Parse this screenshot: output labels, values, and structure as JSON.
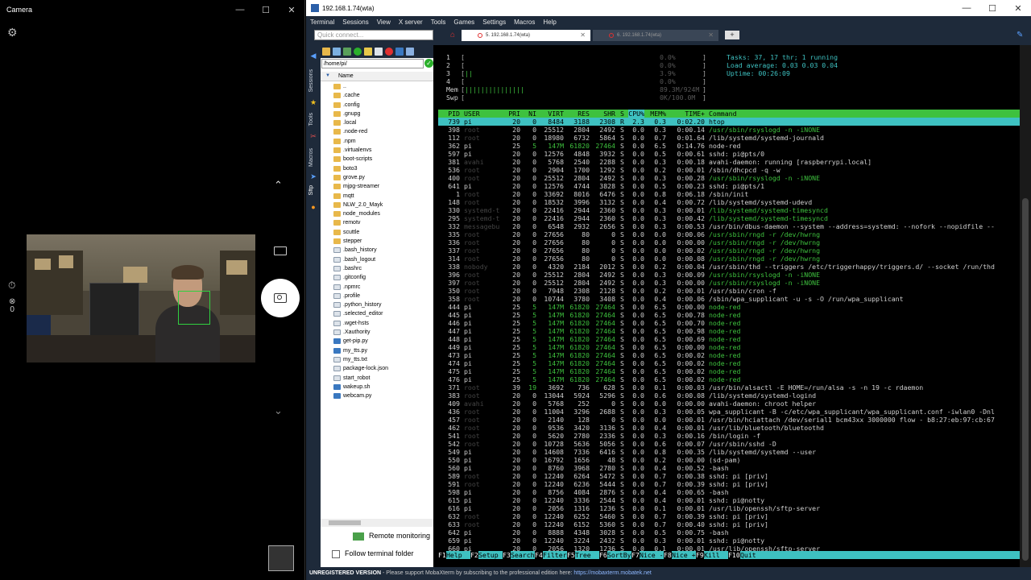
{
  "camera": {
    "title": "Camera",
    "settings_icon": "gear-icon",
    "up_glyph": "⌃",
    "down_glyph": "⌄",
    "timer_glyph": "⏱",
    "hdr_glyph": "⊗",
    "hdr_value": "0"
  },
  "moba": {
    "title": "192.168.1.74(wta)",
    "menu": [
      "Terminal",
      "Sessions",
      "View",
      "X server",
      "Tools",
      "Games",
      "Settings",
      "Macros",
      "Help"
    ],
    "quick_connect_placeholder": "Quick connect...",
    "tabs": [
      {
        "label": "5. 192.168.1.74(wta)"
      },
      {
        "label": "6. 192.168.1.74(wta)"
      }
    ],
    "side_strip": {
      "sessions": "Sessions",
      "tools": "Tools",
      "macros": "Macros",
      "sftp": "Sftp"
    },
    "sftp": {
      "path": "/home/pi/",
      "column_name": "Name",
      "items": [
        {
          "name": "..",
          "type": "dir"
        },
        {
          "name": ".cache",
          "type": "dir"
        },
        {
          "name": ".config",
          "type": "dir"
        },
        {
          "name": ".gnupg",
          "type": "dir"
        },
        {
          "name": ".local",
          "type": "dir"
        },
        {
          "name": ".node-red",
          "type": "dir"
        },
        {
          "name": ".npm",
          "type": "dir"
        },
        {
          "name": ".virtualenvs",
          "type": "dir"
        },
        {
          "name": "boot-scripts",
          "type": "dir"
        },
        {
          "name": "boto3",
          "type": "dir"
        },
        {
          "name": "grove.py",
          "type": "dir"
        },
        {
          "name": "mjpg-streamer",
          "type": "dir"
        },
        {
          "name": "mqtt",
          "type": "dir"
        },
        {
          "name": "NLW_2.0_Mayk",
          "type": "dir"
        },
        {
          "name": "node_modules",
          "type": "dir"
        },
        {
          "name": "remotv",
          "type": "dir"
        },
        {
          "name": "scuttle",
          "type": "dir"
        },
        {
          "name": "stepper",
          "type": "dir"
        },
        {
          "name": ".bash_history",
          "type": "file"
        },
        {
          "name": ".bash_logout",
          "type": "file"
        },
        {
          "name": ".bashrc",
          "type": "file"
        },
        {
          "name": ".gitconfig",
          "type": "file"
        },
        {
          "name": ".npmrc",
          "type": "file"
        },
        {
          "name": ".profile",
          "type": "file"
        },
        {
          "name": ".python_history",
          "type": "file"
        },
        {
          "name": ".selected_editor",
          "type": "file"
        },
        {
          "name": ".wget-hsts",
          "type": "file"
        },
        {
          "name": ".Xauthority",
          "type": "file"
        },
        {
          "name": "get-pip.py",
          "type": "py"
        },
        {
          "name": "my_tts.py",
          "type": "py"
        },
        {
          "name": "my_tts.txt",
          "type": "file"
        },
        {
          "name": "package-lock.json",
          "type": "file"
        },
        {
          "name": "start_robot",
          "type": "file"
        },
        {
          "name": "wakeup.sh",
          "type": "py"
        },
        {
          "name": "webcam.py",
          "type": "py"
        }
      ],
      "remote_monitoring": "Remote monitoring",
      "follow_terminal": "Follow terminal folder"
    },
    "htop": {
      "cpu_meters": [
        {
          "label": "1",
          "bar": "",
          "value": "0.0%"
        },
        {
          "label": "2",
          "bar": "",
          "value": "0.0%"
        },
        {
          "label": "3",
          "bar": "||",
          "value": "3.9%"
        },
        {
          "label": "4",
          "bar": "",
          "value": "0.0%"
        }
      ],
      "mem": {
        "label": "Mem",
        "bar": "|||||||||||||||",
        "value": "89.3M/924M"
      },
      "swp": {
        "label": "Swp",
        "bar": "",
        "value": "0K/100.0M"
      },
      "tasks": "Tasks: 37, 17 thr; 1 running",
      "load": "Load average: 0.03 0.03 0.04",
      "uptime": "Uptime: 00:26:09",
      "columns": [
        "PID",
        "USER",
        "PRI",
        "NI",
        "VIRT",
        "RES",
        "SHR",
        "S",
        "CPU%",
        "MEM%",
        "TIME+",
        "Command"
      ],
      "processes": [
        [
          "739",
          "pi",
          "20",
          "0",
          "8484",
          "3188",
          "2308",
          "R",
          "2.3",
          "0.3",
          "0:02.20",
          "htop"
        ],
        [
          "398",
          "root",
          "20",
          "0",
          "25512",
          "2804",
          "2492",
          "S",
          "0.0",
          "0.3",
          "0:00.14",
          "/usr/sbin/rsyslogd -n -iNONE"
        ],
        [
          "112",
          "root",
          "20",
          "0",
          "18980",
          "6732",
          "5864",
          "S",
          "0.0",
          "0.7",
          "0:01.64",
          "/lib/systemd/systemd-journald"
        ],
        [
          "362",
          "pi",
          "25",
          "5",
          "147M",
          "61820",
          "27464",
          "S",
          "0.0",
          "6.5",
          "0:14.76",
          "node-red"
        ],
        [
          "597",
          "pi",
          "20",
          "0",
          "12576",
          "4848",
          "3932",
          "S",
          "0.0",
          "0.5",
          "0:00.61",
          "sshd: pi@pts/0"
        ],
        [
          "381",
          "avahi",
          "20",
          "0",
          "5768",
          "2540",
          "2288",
          "S",
          "0.0",
          "0.3",
          "0:00.18",
          "avahi-daemon: running [raspberrypi.local]"
        ],
        [
          "536",
          "root",
          "20",
          "0",
          "2904",
          "1700",
          "1292",
          "S",
          "0.0",
          "0.2",
          "0:00.01",
          "/sbin/dhcpcd -q -w"
        ],
        [
          "400",
          "root",
          "20",
          "0",
          "25512",
          "2804",
          "2492",
          "S",
          "0.0",
          "0.3",
          "0:00.28",
          "/usr/sbin/rsyslogd -n -iNONE"
        ],
        [
          "641",
          "pi",
          "20",
          "0",
          "12576",
          "4744",
          "3828",
          "S",
          "0.0",
          "0.5",
          "0:00.23",
          "sshd: pi@pts/1"
        ],
        [
          "1",
          "root",
          "20",
          "0",
          "33692",
          "8016",
          "6476",
          "S",
          "0.0",
          "0.8",
          "0:06.18",
          "/sbin/init"
        ],
        [
          "148",
          "root",
          "20",
          "0",
          "18532",
          "3996",
          "3132",
          "S",
          "0.0",
          "0.4",
          "0:00.72",
          "/lib/systemd/systemd-udevd"
        ],
        [
          "330",
          "systemd-t",
          "20",
          "0",
          "22416",
          "2944",
          "2360",
          "S",
          "0.0",
          "0.3",
          "0:00.01",
          "/lib/systemd/systemd-timesyncd"
        ],
        [
          "295",
          "systemd-t",
          "20",
          "0",
          "22416",
          "2944",
          "2360",
          "S",
          "0.0",
          "0.3",
          "0:00.42",
          "/lib/systemd/systemd-timesyncd"
        ],
        [
          "332",
          "messagebu",
          "20",
          "0",
          "6548",
          "2932",
          "2656",
          "S",
          "0.0",
          "0.3",
          "0:00.53",
          "/usr/bin/dbus-daemon --system --address=systemd: --nofork --nopidfile --"
        ],
        [
          "335",
          "root",
          "20",
          "0",
          "27656",
          "80",
          "0",
          "S",
          "0.0",
          "0.0",
          "0:00.06",
          "/usr/sbin/rngd -r /dev/hwrng"
        ],
        [
          "336",
          "root",
          "20",
          "0",
          "27656",
          "80",
          "0",
          "S",
          "0.0",
          "0.0",
          "0:00.00",
          "/usr/sbin/rngd -r /dev/hwrng"
        ],
        [
          "337",
          "root",
          "20",
          "0",
          "27656",
          "80",
          "0",
          "S",
          "0.0",
          "0.0",
          "0:00.02",
          "/usr/sbin/rngd -r /dev/hwrng"
        ],
        [
          "314",
          "root",
          "20",
          "0",
          "27656",
          "80",
          "0",
          "S",
          "0.0",
          "0.0",
          "0:00.08",
          "/usr/sbin/rngd -r /dev/hwrng"
        ],
        [
          "338",
          "nobody",
          "20",
          "0",
          "4320",
          "2184",
          "2012",
          "S",
          "0.0",
          "0.2",
          "0:00.04",
          "/usr/sbin/thd --triggers /etc/triggerhappy/triggers.d/ --socket /run/thd"
        ],
        [
          "396",
          "root",
          "20",
          "0",
          "25512",
          "2804",
          "2492",
          "S",
          "0.0",
          "0.3",
          "0:00.09",
          "/usr/sbin/rsyslogd -n -iNONE"
        ],
        [
          "397",
          "root",
          "20",
          "0",
          "25512",
          "2804",
          "2492",
          "S",
          "0.0",
          "0.3",
          "0:00.00",
          "/usr/sbin/rsyslogd -n -iNONE"
        ],
        [
          "350",
          "root",
          "20",
          "0",
          "7948",
          "2308",
          "2128",
          "S",
          "0.0",
          "0.2",
          "0:00.01",
          "/usr/sbin/cron -f"
        ],
        [
          "358",
          "root",
          "20",
          "0",
          "10744",
          "3780",
          "3408",
          "S",
          "0.0",
          "0.4",
          "0:00.06",
          "/sbin/wpa_supplicant -u -s -O /run/wpa_supplicant"
        ],
        [
          "444",
          "pi",
          "25",
          "5",
          "147M",
          "61820",
          "27464",
          "S",
          "0.0",
          "6.5",
          "0:00.00",
          "node-red"
        ],
        [
          "445",
          "pi",
          "25",
          "5",
          "147M",
          "61820",
          "27464",
          "S",
          "0.0",
          "6.5",
          "0:00.78",
          "node-red"
        ],
        [
          "446",
          "pi",
          "25",
          "5",
          "147M",
          "61820",
          "27464",
          "S",
          "0.0",
          "6.5",
          "0:00.70",
          "node-red"
        ],
        [
          "447",
          "pi",
          "25",
          "5",
          "147M",
          "61820",
          "27464",
          "S",
          "0.0",
          "6.5",
          "0:00.98",
          "node-red"
        ],
        [
          "448",
          "pi",
          "25",
          "5",
          "147M",
          "61820",
          "27464",
          "S",
          "0.0",
          "6.5",
          "0:00.69",
          "node-red"
        ],
        [
          "449",
          "pi",
          "25",
          "5",
          "147M",
          "61820",
          "27464",
          "S",
          "0.0",
          "6.5",
          "0:00.00",
          "node-red"
        ],
        [
          "473",
          "pi",
          "25",
          "5",
          "147M",
          "61820",
          "27464",
          "S",
          "0.0",
          "6.5",
          "0:00.02",
          "node-red"
        ],
        [
          "474",
          "pi",
          "25",
          "5",
          "147M",
          "61820",
          "27464",
          "S",
          "0.0",
          "6.5",
          "0:00.02",
          "node-red"
        ],
        [
          "475",
          "pi",
          "25",
          "5",
          "147M",
          "61820",
          "27464",
          "S",
          "0.0",
          "6.5",
          "0:00.02",
          "node-red"
        ],
        [
          "476",
          "pi",
          "25",
          "5",
          "147M",
          "61820",
          "27464",
          "S",
          "0.0",
          "6.5",
          "0:00.02",
          "node-red"
        ],
        [
          "371",
          "root",
          "39",
          "19",
          "3692",
          "736",
          "628",
          "S",
          "0.0",
          "0.1",
          "0:00.03",
          "/usr/bin/alsactl -E HOME=/run/alsa -s -n 19 -c rdaemon"
        ],
        [
          "383",
          "root",
          "20",
          "0",
          "13044",
          "5924",
          "5296",
          "S",
          "0.0",
          "0.6",
          "0:00.08",
          "/lib/systemd/systemd-logind"
        ],
        [
          "409",
          "avahi",
          "20",
          "0",
          "5768",
          "252",
          "0",
          "S",
          "0.0",
          "0.0",
          "0:00.00",
          "avahi-daemon: chroot helper"
        ],
        [
          "436",
          "root",
          "20",
          "0",
          "11004",
          "3296",
          "2688",
          "S",
          "0.0",
          "0.3",
          "0:00.05",
          "wpa_supplicant -B -c/etc/wpa_supplicant/wpa_supplicant.conf -iwlan0 -Dnl"
        ],
        [
          "457",
          "root",
          "20",
          "0",
          "2140",
          "128",
          "0",
          "S",
          "0.0",
          "0.0",
          "0:00.01",
          "/usr/bin/hciattach /dev/serial1 bcm43xx 3000000 flow - b8:27:eb:97:cb:67"
        ],
        [
          "462",
          "root",
          "20",
          "0",
          "9536",
          "3420",
          "3136",
          "S",
          "0.0",
          "0.4",
          "0:00.01",
          "/usr/lib/bluetooth/bluetoothd"
        ],
        [
          "541",
          "root",
          "20",
          "0",
          "5620",
          "2780",
          "2336",
          "S",
          "0.0",
          "0.3",
          "0:00.16",
          "/bin/login -f"
        ],
        [
          "542",
          "root",
          "20",
          "0",
          "10728",
          "5636",
          "5056",
          "S",
          "0.0",
          "0.6",
          "0:00.07",
          "/usr/sbin/sshd -D"
        ],
        [
          "549",
          "pi",
          "20",
          "0",
          "14608",
          "7336",
          "6416",
          "S",
          "0.0",
          "0.8",
          "0:00.35",
          "/lib/systemd/systemd --user"
        ],
        [
          "550",
          "pi",
          "20",
          "0",
          "16792",
          "1656",
          "48",
          "S",
          "0.0",
          "0.2",
          "0:00.00",
          "(sd-pam)"
        ],
        [
          "560",
          "pi",
          "20",
          "0",
          "8760",
          "3968",
          "2780",
          "S",
          "0.0",
          "0.4",
          "0:00.52",
          "-bash"
        ],
        [
          "589",
          "root",
          "20",
          "0",
          "12240",
          "6264",
          "5472",
          "S",
          "0.0",
          "0.7",
          "0:00.38",
          "sshd: pi [priv]"
        ],
        [
          "591",
          "root",
          "20",
          "0",
          "12240",
          "6236",
          "5444",
          "S",
          "0.0",
          "0.7",
          "0:00.39",
          "sshd: pi [priv]"
        ],
        [
          "598",
          "pi",
          "20",
          "0",
          "8756",
          "4084",
          "2876",
          "S",
          "0.0",
          "0.4",
          "0:00.65",
          "-bash"
        ],
        [
          "615",
          "pi",
          "20",
          "0",
          "12240",
          "3336",
          "2544",
          "S",
          "0.0",
          "0.4",
          "0:00.01",
          "sshd: pi@notty"
        ],
        [
          "616",
          "pi",
          "20",
          "0",
          "2056",
          "1316",
          "1236",
          "S",
          "0.0",
          "0.1",
          "0:00.01",
          "/usr/lib/openssh/sftp-server"
        ],
        [
          "632",
          "root",
          "20",
          "0",
          "12240",
          "6252",
          "5460",
          "S",
          "0.0",
          "0.7",
          "0:00.39",
          "sshd: pi [priv]"
        ],
        [
          "633",
          "root",
          "20",
          "0",
          "12240",
          "6152",
          "5360",
          "S",
          "0.0",
          "0.7",
          "0:00.40",
          "sshd: pi [priv]"
        ],
        [
          "642",
          "pi",
          "20",
          "0",
          "8888",
          "4348",
          "3028",
          "S",
          "0.0",
          "0.5",
          "0:00.75",
          "-bash"
        ],
        [
          "659",
          "pi",
          "20",
          "0",
          "12240",
          "3224",
          "2432",
          "S",
          "0.0",
          "0.3",
          "0:00.01",
          "sshd: pi@notty"
        ],
        [
          "660",
          "pi",
          "20",
          "0",
          "2056",
          "1320",
          "1236",
          "S",
          "0.0",
          "0.1",
          "0:00.01",
          "/usr/lib/openssh/sftp-server"
        ]
      ],
      "fkeys": [
        {
          "key": "F1",
          "label": "Help"
        },
        {
          "key": "F2",
          "label": "Setup"
        },
        {
          "key": "F3",
          "label": "Search"
        },
        {
          "key": "F4",
          "label": "Filter"
        },
        {
          "key": "F5",
          "label": "Tree"
        },
        {
          "key": "F6",
          "label": "SortBy"
        },
        {
          "key": "F7",
          "label": "Nice -"
        },
        {
          "key": "F8",
          "label": "Nice +"
        },
        {
          "key": "F9",
          "label": "Kill"
        },
        {
          "key": "F10",
          "label": "Quit"
        }
      ]
    },
    "status": {
      "bold": "UNREGISTERED VERSION",
      "text": " -  Please support MobaXterm by subscribing to the professional edition here:  ",
      "link": "https://mobaxterm.mobatek.net"
    },
    "colors": {
      "green": "#3ec13e",
      "cyan": "#3ec1c1",
      "chrome": "#1e2a3a"
    }
  }
}
